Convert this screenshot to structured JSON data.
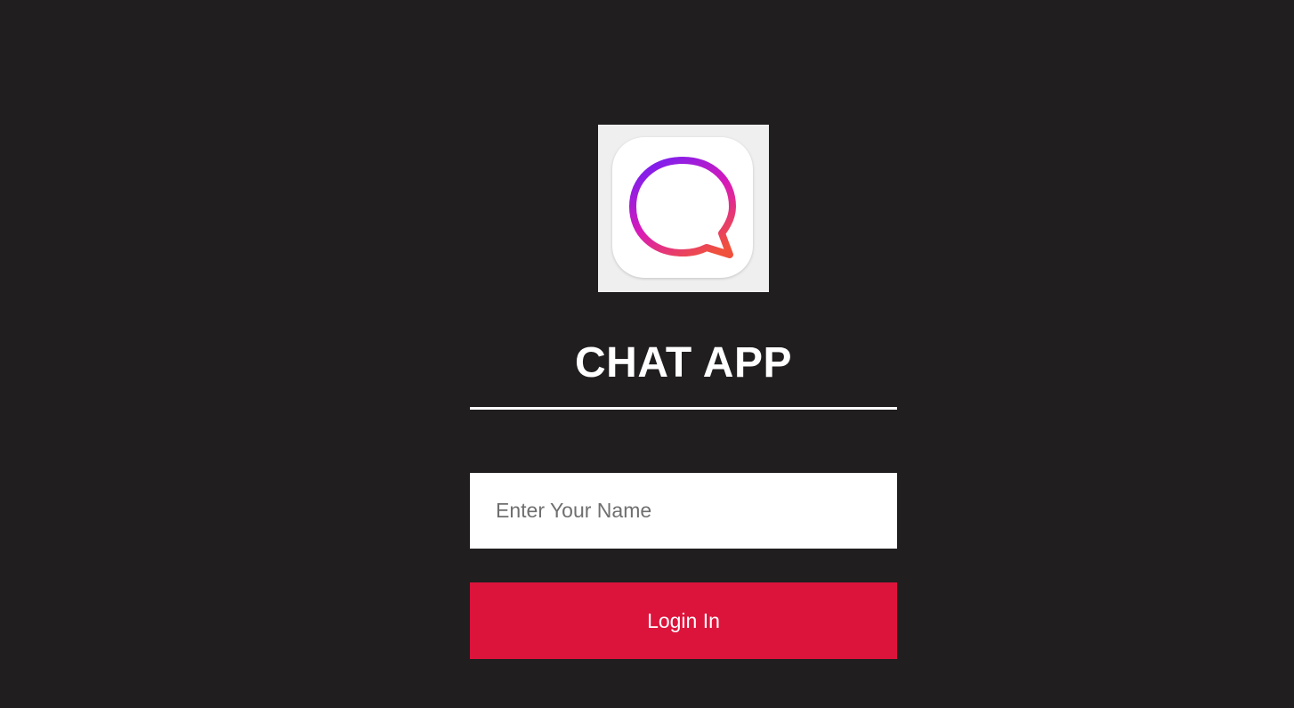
{
  "logo": {
    "icon": "chat-bubble-icon",
    "gradient_colors": [
      "#7a1ff0",
      "#d81ab8",
      "#f0513c"
    ]
  },
  "app": {
    "title": "CHAT APP"
  },
  "login_form": {
    "name_input": {
      "value": "",
      "placeholder": "Enter Your Name"
    },
    "submit_label": "Login In"
  },
  "colors": {
    "background": "#201e1f",
    "accent": "#dc143c",
    "text": "#ffffff"
  }
}
